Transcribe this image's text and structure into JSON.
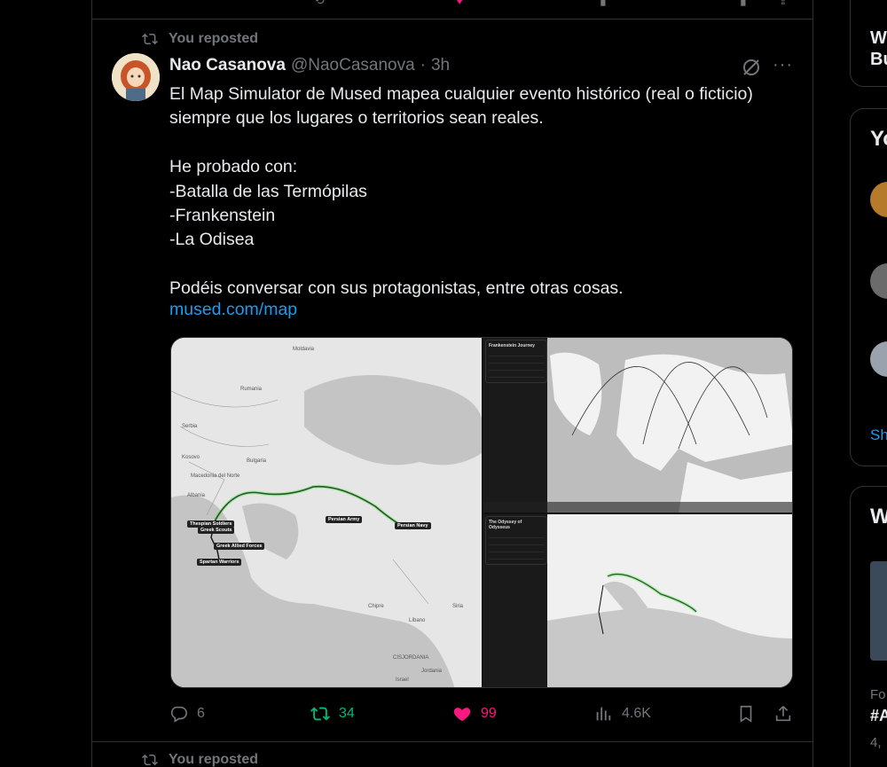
{
  "tweet": {
    "repost_label": "You reposted",
    "author_name": "Nao Casanova",
    "author_handle": "@NaoCasanova",
    "separator": "·",
    "time": "3h",
    "more_label": "···",
    "body": "El Map Simulator de Mused mapea cualquier evento histórico (real o ficticio) siempre que los lugares o territorios sean reales.\n\nHe probado con:\n-Batalla de las Termópilas\n-Frankenstein\n-La Odisea\n\nPodéis conversar con sus protagonistas, entre otras cosas.",
    "link": "mused.com/map",
    "stats": {
      "replies": "6",
      "reposts": "34",
      "likes": "99",
      "views": "4.6K"
    }
  },
  "media": {
    "map1_labels": [
      "Moldavia",
      "Rumania",
      "Serbia",
      "Kosovo",
      "Bulgaria",
      "Macedonia del Norte",
      "Albania",
      "Chipre",
      "Siria",
      "Líbano",
      "Israel",
      "Jordania",
      "CISJORDANIA"
    ],
    "map1_units": [
      "Thespian Soldiers",
      "Greek Scouts",
      "Greek Allied Forces",
      "Spartan Warriors",
      "Persian Army",
      "Persian Navy"
    ],
    "map2_title": "Frankenstein Journey",
    "map3_title": "The Odyssey of Odysseus"
  },
  "next_item": {
    "repost_label": "You reposted"
  },
  "sidebar": {
    "card1_text": "W\nBu",
    "card2_heading": "Yo",
    "card2_link": "Sh",
    "card3_heading": "W",
    "card3_meta": "Fo",
    "card3_hashtag": "#A",
    "card3_count": "4,"
  },
  "colors": {
    "background": "#000000",
    "border": "#2f3336",
    "text": "#e7e9ea",
    "muted": "#71767b",
    "link": "#1d9bf0",
    "repost_green": "#00ba7c",
    "like_pink": "#f91880"
  },
  "icons": [
    "repost-icon",
    "grok-icon",
    "more-icon",
    "reply-icon",
    "heart-icon",
    "views-icon",
    "bookmark-icon",
    "share-icon"
  ]
}
